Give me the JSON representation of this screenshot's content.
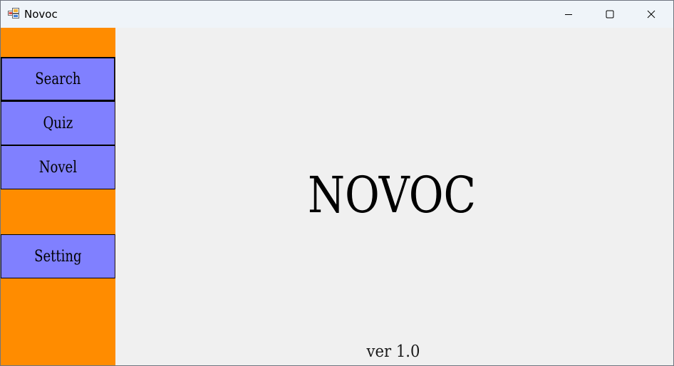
{
  "window": {
    "title": "Novoc",
    "icon": "windows-forms-app-icon",
    "controls": {
      "minimize_icon": "minimize-icon",
      "maximize_icon": "maximize-icon",
      "close_icon": "close-icon"
    }
  },
  "sidebar": {
    "background_color": "#ff8c00",
    "button_color": "#8080ff",
    "items": [
      {
        "label": "Search"
      },
      {
        "label": "Quiz"
      },
      {
        "label": "Novel"
      },
      {
        "label": "Setting"
      }
    ]
  },
  "main": {
    "logo_text": "NOVOC",
    "version": "ver 1.0",
    "background_color": "#f0f0f0"
  }
}
